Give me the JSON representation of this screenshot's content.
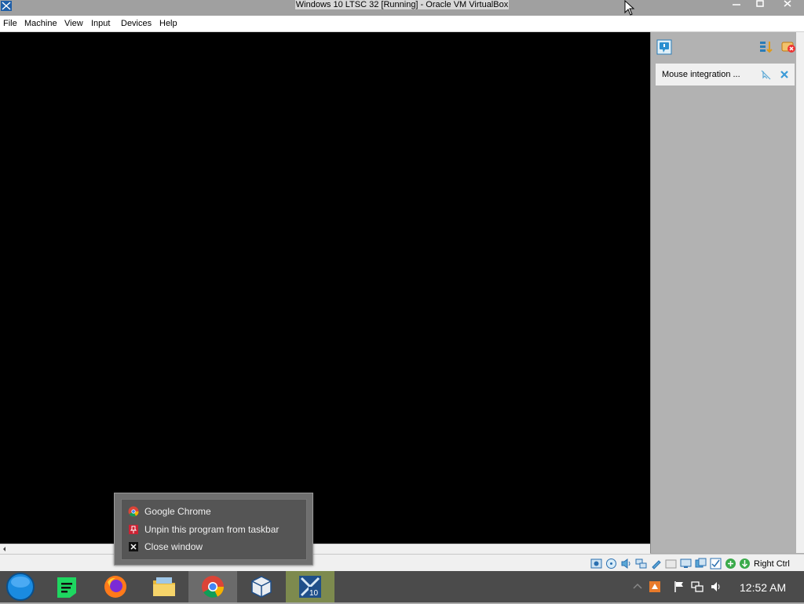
{
  "window": {
    "title": "Windows 10 LTSC 32 [Running] - Oracle VM VirtualBox",
    "controls": [
      "minimize",
      "maximize",
      "close"
    ]
  },
  "menubar": {
    "items": [
      "File",
      "Machine",
      "View",
      "Input",
      "Devices",
      "Help"
    ]
  },
  "notification": {
    "text": "Mouse integration ..."
  },
  "statusbar": {
    "host_key_label": "Right Ctrl",
    "icons": [
      "hard-disk-icon",
      "optical-drive-icon",
      "audio-icon",
      "network-icon",
      "usb-icon",
      "shared-folders-icon",
      "display-icon",
      "video-capture-icon",
      "capture-icon",
      "cpu-icon",
      "mouse-integration-icon",
      "keyboard-icon"
    ]
  },
  "jumplist": {
    "items": [
      {
        "label": "Google Chrome",
        "icon": "chrome-icon"
      },
      {
        "label": "Unpin this program from taskbar",
        "icon": "unpin-icon"
      },
      {
        "label": "Close window",
        "icon": "close-icon"
      }
    ]
  },
  "taskbar": {
    "apps": [
      "start-orb",
      "spotify",
      "firefox",
      "file-explorer",
      "chrome",
      "virtualbox",
      "windows10-vm"
    ],
    "active_app": "chrome",
    "clock": "12:52 AM",
    "tray_icons": [
      "show-hidden-icons",
      "warning-icon",
      "action-center-flag-icon",
      "network-icon",
      "volume-icon"
    ]
  },
  "colors": {
    "taskbar_bg": "#4b4b4b",
    "vm_screen": "#000000",
    "panel_bg": "#b2b2b2"
  }
}
